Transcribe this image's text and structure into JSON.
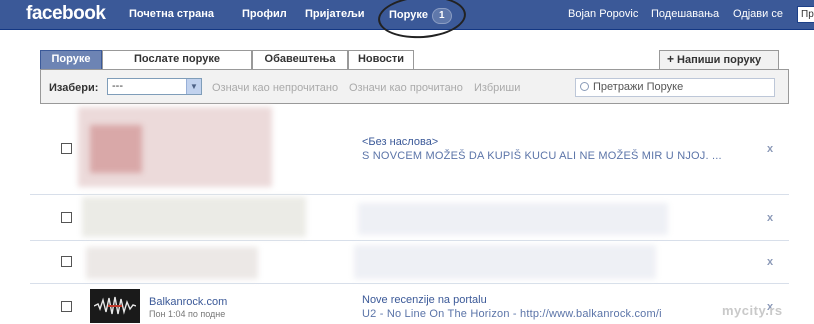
{
  "topbar": {
    "logo": "facebook",
    "nav": {
      "home": "Почетна страна",
      "profile": "Профил",
      "friends": "Пријатељи",
      "inbox": "Поруке",
      "inbox_count": "1",
      "user": "Bojan Popovic",
      "settings": "Подешавања",
      "logout": "Одјави се"
    },
    "search_value": "Пр"
  },
  "tabs": [
    "Поруке",
    "Послате поруке",
    "Обавештења",
    "Новости"
  ],
  "active_tab": "Поруке",
  "compose_label": "Напиши поруку",
  "toolbar": {
    "select_label": "Изабери:",
    "select_value": "---",
    "mark_unread": "Означи као непрочитано",
    "mark_read": "Означи као прочитано",
    "delete": "Избриши",
    "search_placeholder": "Претражи Поруке"
  },
  "messages": [
    {
      "subject": "<Без наслова>",
      "preview": "S NOVCEM MOŽEŠ DA KUPIŠ KUCU ALI NE MOŽEŠ MIR U NJOJ. ..."
    },
    {
      "sender": "Balkanrock.com",
      "time": "Пон 1:04 по подне",
      "subject": "Nove recenzije na portalu",
      "preview": "U2 - No Line On The Horizon - http://www.balkanrock.com/i..."
    }
  ],
  "delete_glyph": "x",
  "watermark": "mycity.rs",
  "colors": {
    "topbar": "#3b5998",
    "active_tab": "#6d84b4",
    "link": "#3b5998"
  }
}
